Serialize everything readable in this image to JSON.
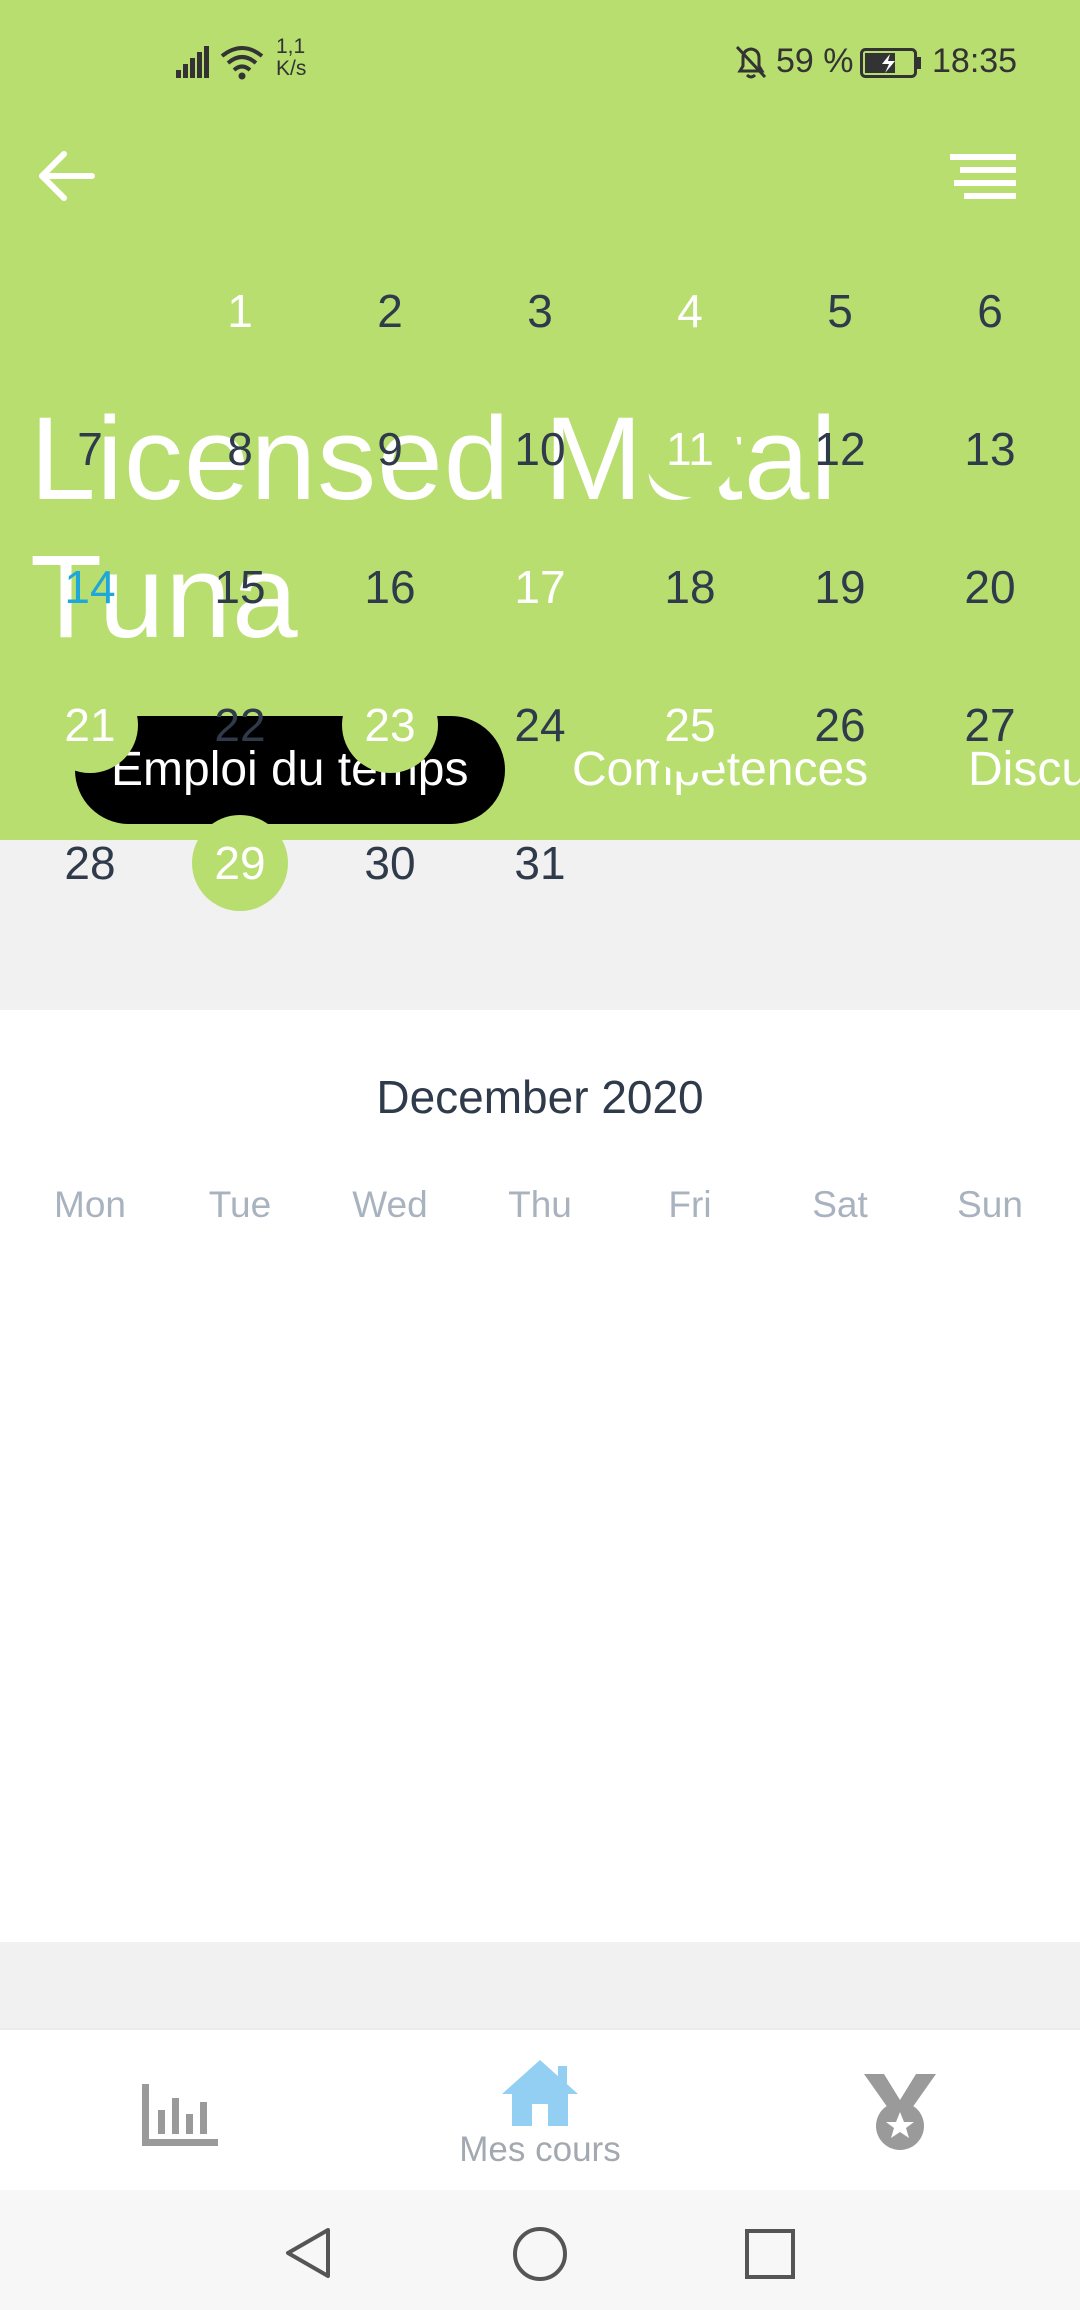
{
  "status_bar": {
    "network_speed_value": "1,1",
    "network_speed_unit": "K/s",
    "battery": "59 %",
    "time": "18:35",
    "icons": [
      "signal-icon",
      "wifi-icon",
      "bell-off-icon",
      "battery-charging-icon"
    ]
  },
  "header": {
    "title": "Licensed Metal Tuna",
    "background_color": "#b8de70",
    "back_icon": "arrow-left-icon",
    "menu_icon": "menu-icon"
  },
  "tabs": [
    {
      "label": "Emploi du temps",
      "active": true
    },
    {
      "label": "Compétences",
      "active": false
    },
    {
      "label": "Discu",
      "active": false
    }
  ],
  "calendar": {
    "month_label": "December 2020",
    "weekdays": [
      "Mon",
      "Tue",
      "Wed",
      "Thu",
      "Fri",
      "Sat",
      "Sun"
    ],
    "days": [
      "1",
      "2",
      "3",
      "4",
      "5",
      "6",
      "7",
      "8",
      "9",
      "10",
      "11",
      "12",
      "13",
      "14",
      "15",
      "16",
      "17",
      "18",
      "19",
      "20",
      "21",
      "22",
      "23",
      "24",
      "25",
      "26",
      "27",
      "28",
      "29",
      "30",
      "31"
    ],
    "marked_days": [
      1,
      4,
      11,
      17,
      21,
      23,
      25,
      29
    ],
    "today": 14,
    "marked_color": "#b8de70",
    "today_color": "#1ea7d8"
  },
  "bottom_nav": {
    "items": [
      {
        "icon": "bar-chart-icon",
        "label": ""
      },
      {
        "icon": "home-icon",
        "label": "Mes cours",
        "active": true
      },
      {
        "icon": "medal-icon",
        "label": ""
      }
    ]
  },
  "system_nav": {
    "icons": [
      "back-triangle-icon",
      "home-circle-icon",
      "recents-square-icon"
    ]
  }
}
